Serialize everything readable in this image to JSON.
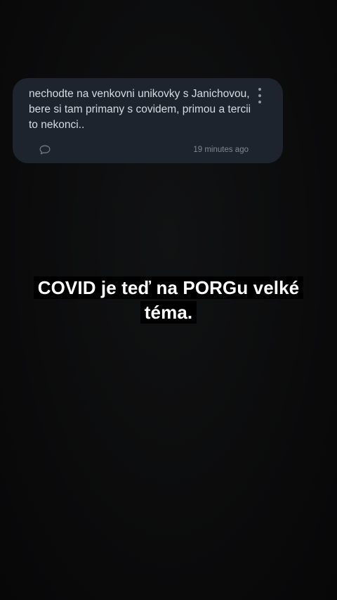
{
  "message_card": {
    "text": "nechodte na venkovni unikovky s Janichovou, bere si tam primany s covidem, primou a tercii to nekonci..",
    "timestamp": "19 minutes ago",
    "more_icon": "more-vertical-icon",
    "comment_icon": "comment-bubble-icon"
  },
  "caption": {
    "text": "COVID je teď na PORGu velké téma."
  },
  "colors": {
    "background": "#0b0b0c",
    "card_background": "#1d242d",
    "card_text": "#d5dbe1",
    "muted_text": "#7e8791",
    "caption_text": "#ffffff"
  }
}
